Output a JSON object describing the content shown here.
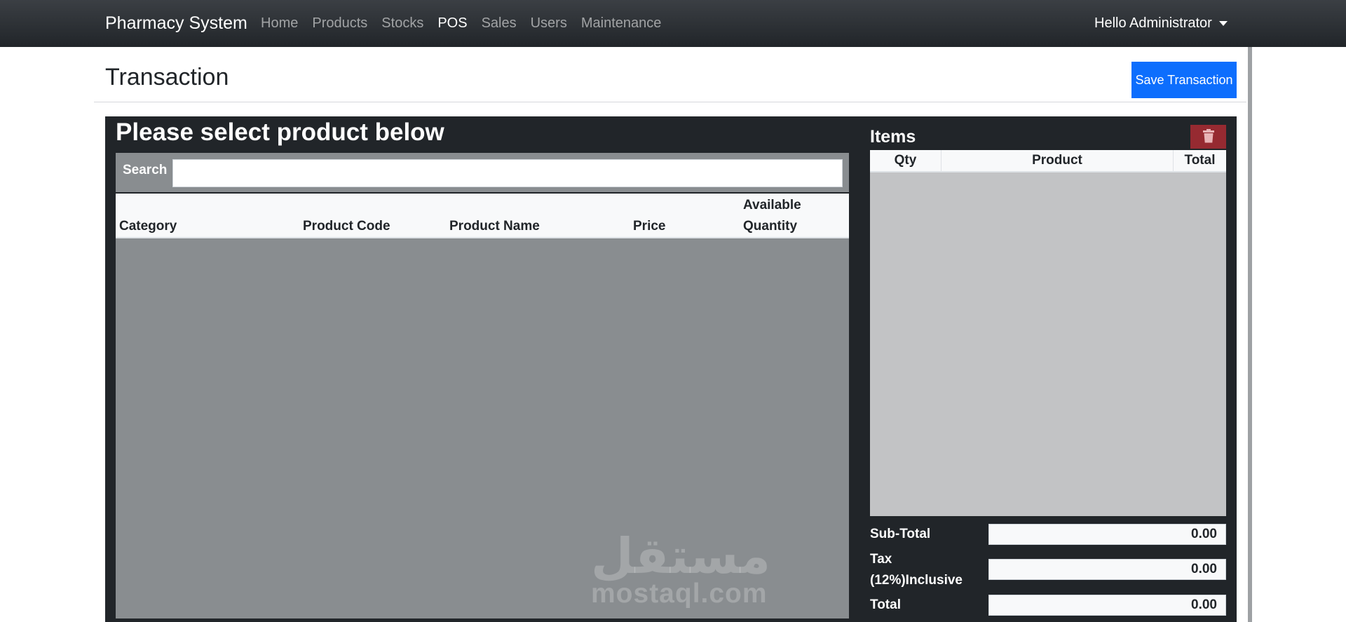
{
  "navbar": {
    "brand": "Pharmacy System",
    "links": [
      {
        "label": "Home",
        "active": false
      },
      {
        "label": "Products",
        "active": false
      },
      {
        "label": "Stocks",
        "active": false
      },
      {
        "label": "POS",
        "active": true
      },
      {
        "label": "Sales",
        "active": false
      },
      {
        "label": "Users",
        "active": false
      },
      {
        "label": "Maintenance",
        "active": false
      }
    ],
    "user_greeting": "Hello Administrator"
  },
  "header": {
    "title": "Transaction",
    "save_label": "Save Transaction"
  },
  "products": {
    "title": "Please select product below",
    "search_label": "Search",
    "search_value": "",
    "columns": {
      "category": "Category",
      "code": "Product Code",
      "name": "Product Name",
      "price": "Price",
      "qty_line1": "Available",
      "qty_line2": "Quantity"
    },
    "rows": []
  },
  "items": {
    "title": "Items",
    "columns": {
      "qty": "Qty",
      "product": "Product",
      "total": "Total"
    },
    "rows": [],
    "clear_icon": "trash-icon"
  },
  "summary": {
    "subtotal_label": "Sub-Total",
    "subtotal_value": "0.00",
    "tax_label_line1": "Tax",
    "tax_label_line2": "(12%)Inclusive",
    "tax_value": "0.00",
    "total_label": "Total",
    "total_value": "0.00"
  },
  "watermark": {
    "arabic": "مستقل",
    "latin": "mostaql.com"
  },
  "colors": {
    "navbar": "#212529",
    "panel": "#212529",
    "primary": "#0d6efd",
    "danger": "#962a31",
    "product_area": "#898d90",
    "items_area": "#c2c3c5"
  }
}
